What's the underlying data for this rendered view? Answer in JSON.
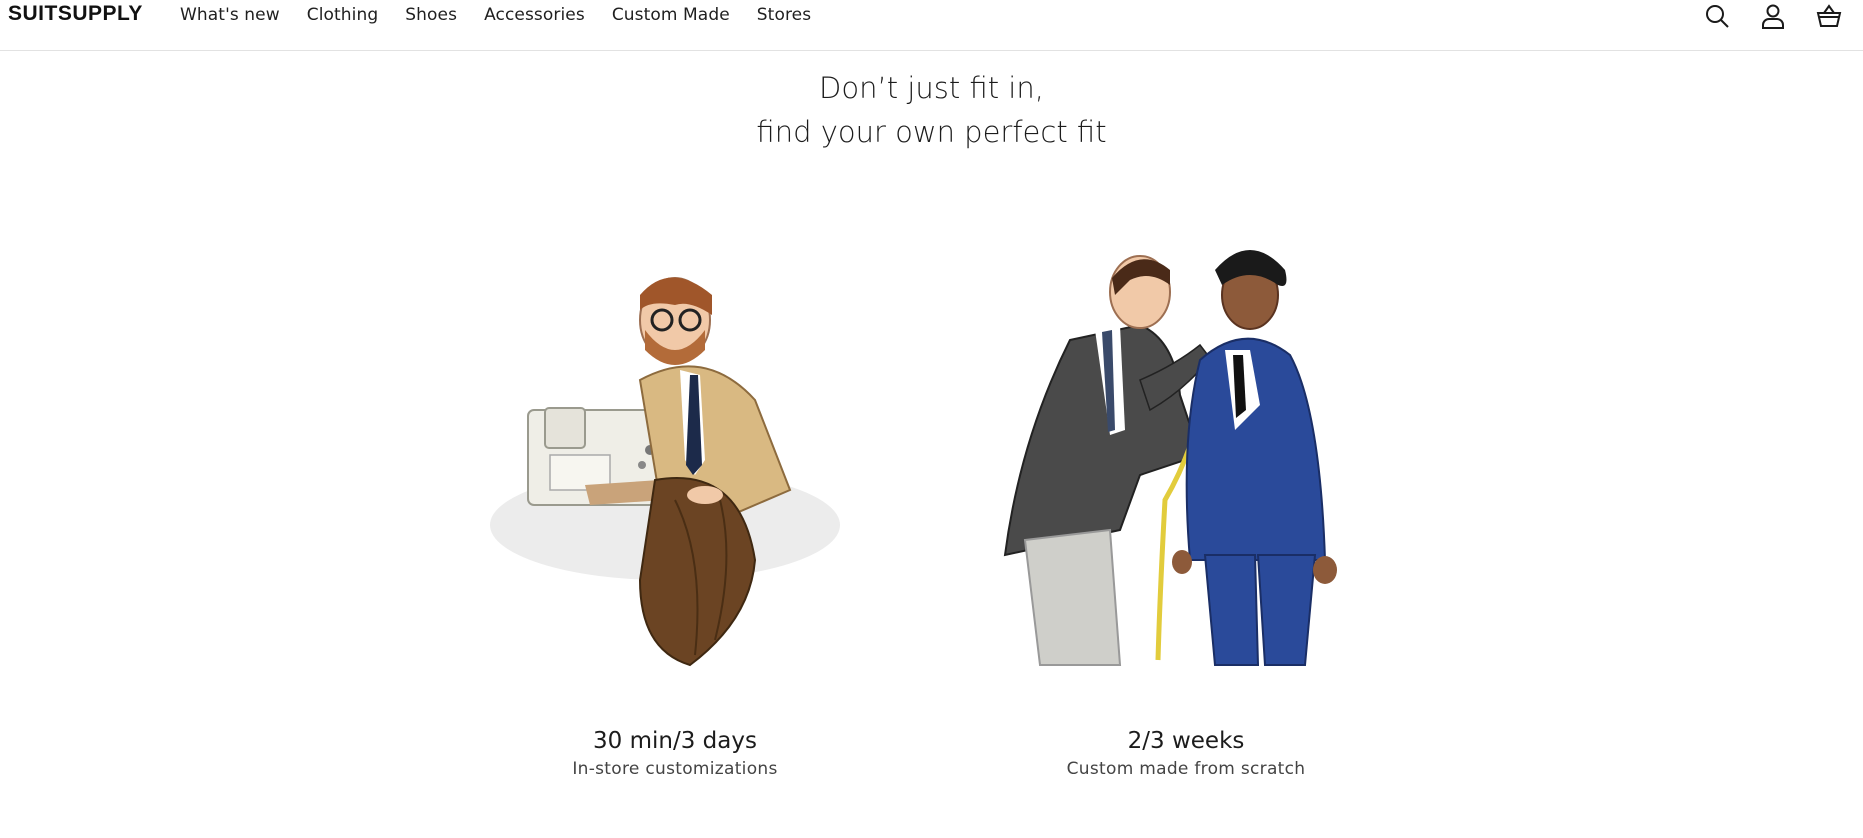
{
  "header": {
    "logo": "SUITSUPPLY",
    "nav": [
      "What's new",
      "Clothing",
      "Shoes",
      "Accessories",
      "Custom Made",
      "Stores"
    ],
    "icons": [
      "search-icon",
      "account-icon",
      "basket-icon"
    ]
  },
  "hero": {
    "line1": "Don’t just fit in,",
    "line2": "find your own perfect fit"
  },
  "cards": [
    {
      "title": "30 min/3 days",
      "subtitle": "In-store customizations",
      "image": "tailor-sewing-illustration"
    },
    {
      "title": "2/3 weeks",
      "subtitle": "Custom made from scratch",
      "image": "tailor-measuring-illustration"
    }
  ]
}
